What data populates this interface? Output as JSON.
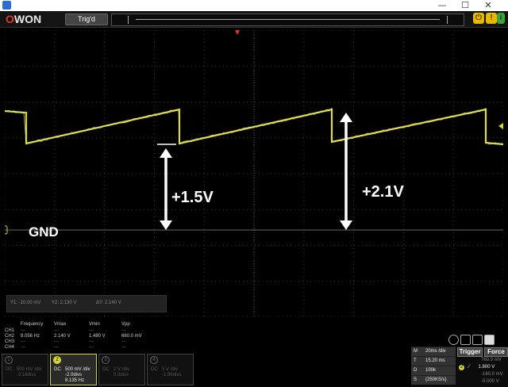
{
  "window": {
    "minimize": "—",
    "maximize": "☐",
    "close": "✕"
  },
  "toolbar": {
    "brand_o": "O",
    "brand_rest": "WON",
    "trig_status": "Trig'd"
  },
  "annotations": {
    "left_voltage": "+1.5V",
    "right_voltage": "+2.1V",
    "ground": "GND"
  },
  "cursor": {
    "y1": "Y1: -10.00 mV",
    "y2": "Y2: 2.130 V",
    "dy": "ΔY: 2.140 V"
  },
  "measure": {
    "headers": [
      "",
      "Frequency",
      "Vmax",
      "Vmin",
      "Vpp"
    ],
    "rows": [
      [
        "CH1",
        "---",
        "---",
        "---",
        "---"
      ],
      [
        "CH2",
        "8.056 Hz",
        "2.140 V",
        "1.480 V",
        "660.0 mV"
      ],
      [
        "CH3",
        "---",
        "---",
        "---",
        "---"
      ],
      [
        "CH4",
        "---",
        "---",
        "---",
        "---"
      ]
    ]
  },
  "channels": [
    {
      "num": "1",
      "coupling": "DC",
      "scale": "500 mV /div",
      "divs": "-3.16divs",
      "extra": ""
    },
    {
      "num": "2",
      "coupling": "DC",
      "scale": "500 mV /div",
      "divs": "-2.0divs",
      "extra": "8.135 Hz"
    },
    {
      "num": "3",
      "coupling": "DC",
      "scale": "2 V /div",
      "divs": "0.0divs",
      "extra": ""
    },
    {
      "num": "4",
      "coupling": "DC",
      "scale": "5 V /div",
      "divs": "-1.96divs",
      "extra": ""
    }
  ],
  "timebase": {
    "m_key": "M",
    "m_val": "20ms /div",
    "t_key": "T",
    "t_val": "15.20 ms",
    "d_key": "D",
    "d_val": "100k",
    "s_key": "S",
    "s_val": "(250KS/s)"
  },
  "trigger": {
    "trigger_label": "Trigger",
    "force_label": "Force",
    "level_top": "760.0 mV",
    "level_ch": "2",
    "level_val": "1.800 V",
    "level_mid": "-160.0 mV",
    "level_bot": "-5.000 V"
  },
  "colors": {
    "ch2": "#d6d23a",
    "background": "#000000",
    "grid": "#3a3a3a",
    "annotation": "#ffffff"
  }
}
